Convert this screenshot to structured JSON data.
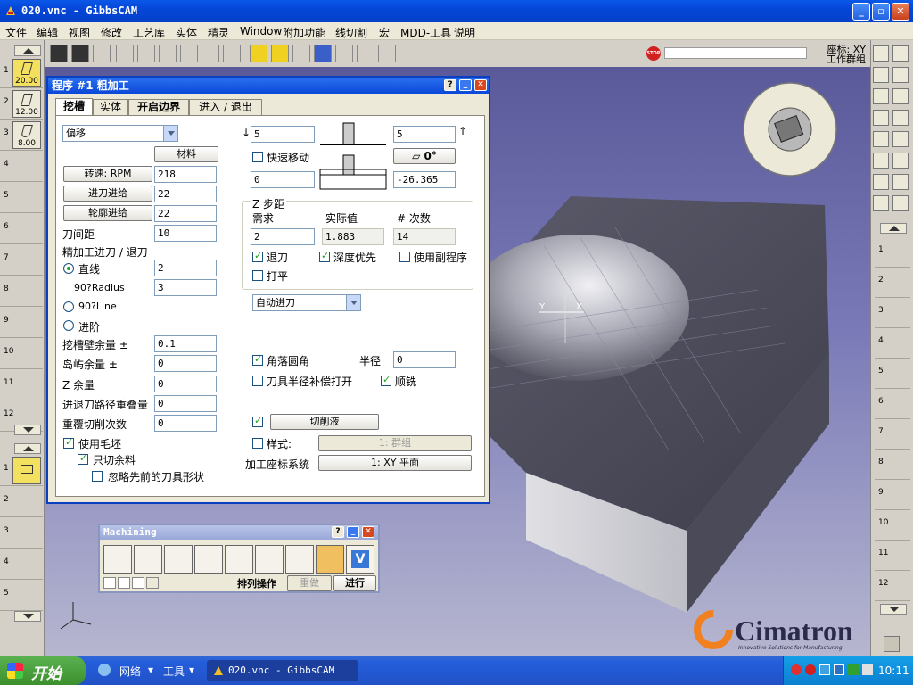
{
  "window": {
    "title": "020.vnc - GibbsCAM"
  },
  "menu": [
    "文件",
    "编辑",
    "视图",
    "修改",
    "工艺库",
    "实体",
    "精灵",
    "Window",
    "附加功能",
    "线切割",
    "宏",
    "MDD-工具",
    "说明"
  ],
  "status": {
    "coord_line1": "座标: XY",
    "coord_line2": "工作群组",
    "stop_label": "STOP"
  },
  "tools": [
    {
      "num": "1",
      "value": "20.00"
    },
    {
      "num": "2",
      "value": "12.00"
    },
    {
      "num": "3",
      "value": "8.00"
    }
  ],
  "tool_slots": [
    "4",
    "5",
    "6",
    "7",
    "8",
    "9",
    "10",
    "11",
    "12"
  ],
  "process_slots": [
    "1",
    "2",
    "3",
    "4",
    "5"
  ],
  "right_slots": [
    "1",
    "2",
    "3",
    "4",
    "5",
    "6",
    "7",
    "8",
    "9",
    "10",
    "11",
    "12"
  ],
  "dialog": {
    "title": "程序 #1 粗加工",
    "tabs": [
      "挖槽",
      "实体",
      "开启边界",
      "进入 / 退出"
    ],
    "mode": "偏移",
    "material_btn": "材料",
    "speed_btn": "转速: RPM",
    "speed_val": "218",
    "feed_btn": "进刀进给",
    "feed_val": "22",
    "contour_btn": "轮廓进给",
    "contour_val": "22",
    "stepover_lbl": "刀间距",
    "stepover_val": "10",
    "finish_lbl": "精加工进刀 / 退刀",
    "line_lbl": "直线",
    "line_val": "2",
    "radius_lbl": "90?Radius",
    "radius_val": "3",
    "line90_lbl": "90?Line",
    "step_lbl": "进阶",
    "wall_lbl": "挖槽壁余量 ±",
    "wall_val": "0.1",
    "island_lbl": "岛屿余量 ±",
    "island_val": "0",
    "z_lbl": "Z 余量",
    "z_val": "0",
    "overlap_lbl": "进退刀路径重叠量",
    "overlap_val": "0",
    "repeat_lbl": "重覆切削次数",
    "repeat_val": "0",
    "use_stock": "使用毛坯",
    "cut_remain": "只切余料",
    "ignore_prev": "忽略先前的刀具形状",
    "top_val": "5",
    "top_right_val": "5",
    "rapid_lbl": "快速移动",
    "angle_val": "0°",
    "bottom_val": "0",
    "bottom_right_val": "-26.365",
    "zstep_title": "Z 步距",
    "need_lbl": "需求",
    "actual_lbl": "实际值",
    "count_lbl": "# 次数",
    "need_val": "2",
    "actual_val": "1.883",
    "count_val": "14",
    "retract_lbl": "退刀",
    "depth_first_lbl": "深度优先",
    "use_sub_lbl": "使用副程序",
    "flat_lbl": "打平",
    "entry_mode": "自动进刀",
    "corner_lbl": "角落圆角",
    "radius2_lbl": "半径",
    "radius2_val": "0",
    "comp_lbl": "刀具半径补偿打开",
    "climb_lbl": "顺铣",
    "coolant_btn": "切削液",
    "style_lbl": "样式:",
    "style_val": "1: 群组",
    "cs_lbl": "加工座标系统",
    "cs_val": "1: XY 平面"
  },
  "machining": {
    "title": "Machining",
    "order_btn": "排列操作",
    "redo_btn": "重做",
    "run_btn": "进行"
  },
  "taskbar": {
    "start": "开始",
    "net": "网络",
    "tools": "工具",
    "task": "020.vnc - GibbsCAM",
    "clock": "10:11"
  },
  "logo": {
    "name": "Cimatron",
    "tagline": "Innovative Solutions for Manufacturing"
  },
  "viewport_labels": {
    "y": "Y",
    "x": "X"
  }
}
